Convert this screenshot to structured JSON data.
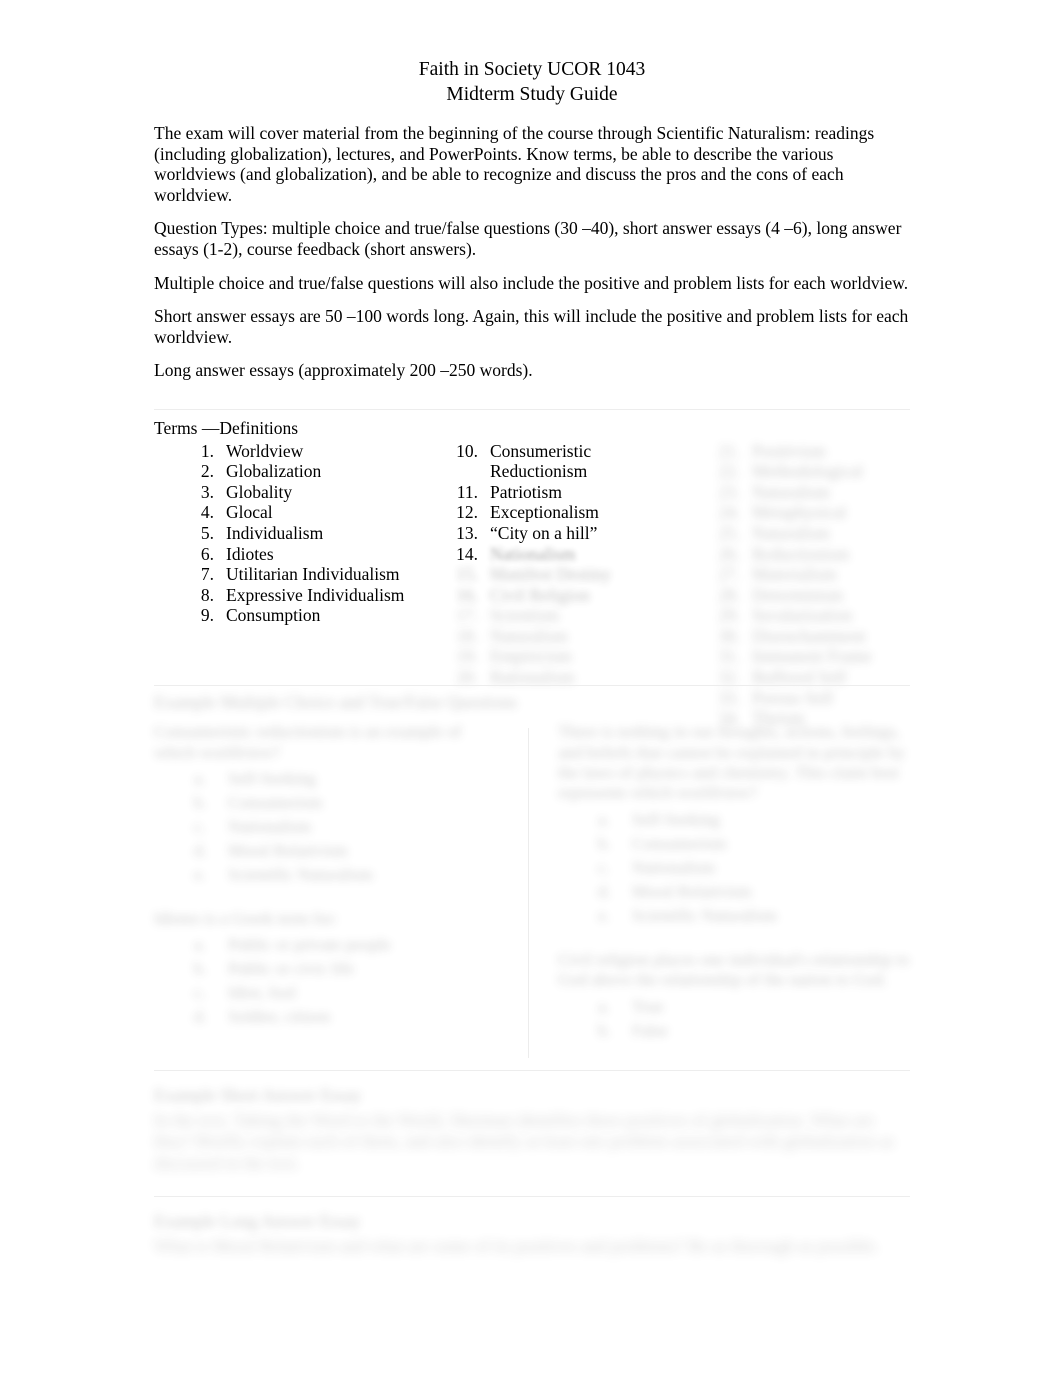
{
  "document": {
    "title_lines": [
      "Faith in Society UCOR 1043",
      "Midterm Study Guide"
    ],
    "paragraphs": [
      "The exam will cover material from the beginning of the course through Scientific Naturalism: readings (including globalization), lectures, and PowerPoints. Know terms, be able to describe the various worldviews (and globalization), and be able to recognize and discuss the pros and the cons of each worldview.",
      "Question Types: multiple choice and true/false questions (30 –40), short answer essays (4 –6), long answer essays (1-2), course feedback (short answers).",
      "Multiple choice and true/false questions will also include the positive and problem lists for each worldview.",
      "Short answer essays are 50 –100 words long. Again, this will include the positive and problem lists for each worldview.",
      "Long answer essays (approximately 200 –250 words)."
    ]
  },
  "terms_section": {
    "heading": "Terms —Definitions",
    "column_1": [
      {
        "num": "1.",
        "label": "Worldview"
      },
      {
        "num": "2.",
        "label": "Globalization"
      },
      {
        "num": "3.",
        "label": "Globality"
      },
      {
        "num": "4.",
        "label": "Glocal"
      },
      {
        "num": "5.",
        "label": "Individualism"
      },
      {
        "num": "6.",
        "label": "Idiotes"
      },
      {
        "num": "7.",
        "label": "Utilitarian Individualism"
      },
      {
        "num": "8.",
        "label": "Expressive Individualism"
      },
      {
        "num": "9.",
        "label": "Consumption"
      }
    ],
    "column_2": [
      {
        "num": "10.",
        "label": "Consumeristic Reductionism",
        "state": "clear"
      },
      {
        "num": "11.",
        "label": "Patriotism",
        "state": "clear"
      },
      {
        "num": "12.",
        "label": "Exceptionalism",
        "state": "clear"
      },
      {
        "num": "13.",
        "label": "“City on a hill”",
        "state": "clear"
      },
      {
        "num": "14.",
        "label": "Nationalism",
        "state": "blurred"
      },
      {
        "num": "15.",
        "label": "Manifest Destiny",
        "state": "blurred"
      },
      {
        "num": "16.",
        "label": "Civil Religion",
        "state": "blurred"
      },
      {
        "num": "17.",
        "label": "Scientism",
        "state": "blurred"
      },
      {
        "num": "18.",
        "label": "Naturalism",
        "state": "blurred"
      },
      {
        "num": "19.",
        "label": "Empiricism",
        "state": "blurred"
      },
      {
        "num": "20.",
        "label": "Rationalism",
        "state": "blurred"
      }
    ],
    "column_3": [
      {
        "num": "21.",
        "label": "Positivism",
        "state": "blurred"
      },
      {
        "num": "22.",
        "label": "Methodological",
        "state": "blurred"
      },
      {
        "num": "23.",
        "label": "Naturalism",
        "state": "blurred"
      },
      {
        "num": "24.",
        "label": "Metaphysical",
        "state": "blurred"
      },
      {
        "num": "25.",
        "label": "Naturalism",
        "state": "blurred"
      },
      {
        "num": "26.",
        "label": "Reductionism",
        "state": "blurred"
      },
      {
        "num": "27.",
        "label": "Materialism",
        "state": "blurred"
      },
      {
        "num": "28.",
        "label": "Determinism",
        "state": "blurred"
      },
      {
        "num": "29.",
        "label": "Secularization",
        "state": "blurred"
      },
      {
        "num": "30.",
        "label": "Disenchantment",
        "state": "blurred"
      },
      {
        "num": "31.",
        "label": "Immanent Frame",
        "state": "blurred"
      },
      {
        "num": "32.",
        "label": "Buffered Self",
        "state": "blurred"
      },
      {
        "num": "33.",
        "label": "Porous Self",
        "state": "blurred"
      },
      {
        "num": "34.",
        "label": "Theism",
        "state": "blurred"
      }
    ]
  },
  "example_mc_section": {
    "heading": "Example Multiple Choice and True/False Questions",
    "left_column": {
      "question_1": {
        "stem": "Consumeristic reductionism is an example of which worldview?",
        "choices": [
          {
            "letter": "a.",
            "text": "Self-Seeking"
          },
          {
            "letter": "b.",
            "text": "Consumerism"
          },
          {
            "letter": "c.",
            "text": "Nationalism"
          },
          {
            "letter": "d.",
            "text": "Moral Relativism"
          },
          {
            "letter": "e.",
            "text": "Scientific Naturalism"
          }
        ]
      },
      "question_2": {
        "stem": "Idiotes is a Greek term for:",
        "choices": [
          {
            "letter": "a.",
            "text": "Public or private people"
          },
          {
            "letter": "b.",
            "text": "Public or civic life"
          },
          {
            "letter": "c.",
            "text": "Idiot, fool"
          },
          {
            "letter": "d.",
            "text": "Soldier, citizen"
          }
        ]
      }
    },
    "right_column": {
      "question_3": {
        "stem": "There is nothing in our thoughts, actions, feelings, and beliefs that cannot be explained in principle by the laws of physics and chemistry. This claim best represents which worldview?",
        "choices": [
          {
            "letter": "a.",
            "text": "Self-Seeking"
          },
          {
            "letter": "b.",
            "text": "Consumerism"
          },
          {
            "letter": "c.",
            "text": "Nationalism"
          },
          {
            "letter": "d.",
            "text": "Moral Relativism"
          },
          {
            "letter": "e.",
            "text": "Scientific Naturalism"
          }
        ]
      },
      "question_4": {
        "stem": "Civil religion places one individual's relationship to God above the relationship of the nation to God.",
        "choices": [
          {
            "letter": "a.",
            "text": "True"
          },
          {
            "letter": "b.",
            "text": "False"
          }
        ]
      }
    }
  },
  "example_short_answer_section": {
    "heading": "Example Short Answer Essay",
    "body": "In the text, Taking the Word to the World, Sherman identifies three positives of globalization. What are they? Briefly explain each of them, and also identify at least one problem associated with globalization as discussed in the text."
  },
  "example_long_answer_section": {
    "heading": "Example Long Answer Essay",
    "body": "What is Moral Relativism and what are some of its positives and problems? Be as thorough as possible."
  },
  "rendering_notes": {
    "divider_color": "#ededed",
    "text_color": "#000000",
    "background_color": "#ffffff"
  }
}
